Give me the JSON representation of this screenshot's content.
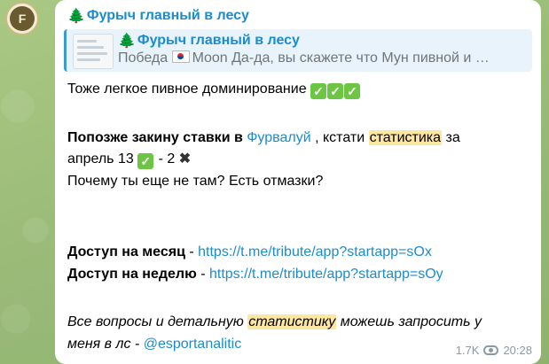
{
  "avatar": {
    "glyph": "F"
  },
  "message": {
    "sender": "Фурыч главный в лесу",
    "reply": {
      "title": "Фурыч главный в лесу",
      "text_prefix": "Победа",
      "text_rest": "Moon Да-да, вы скажете что Мун пивной и …"
    },
    "line1": "Тоже легкое пивное доминирование",
    "line2_bold": "Попозже закину ставки в",
    "line2_link": "Фурвалуй",
    "line2_rest": ", кстати",
    "line2_highlight": "статистика",
    "line2_tail": "за",
    "line3_prefix": "апрель 13",
    "line3_mid": "- 2",
    "line4": "Почему ты еще не там? Есть отмазки?",
    "month_label": "Доступ на месяц",
    "month_link": "https://t.me/tribute/app?startapp=sOx",
    "week_label": "Доступ на неделю",
    "week_link": "https://t.me/tribute/app?startapp=sOy",
    "footer_pre": "Все вопросы и детальную",
    "footer_highlight": "статистику",
    "footer_post": "можешь запросить у",
    "footer_line2": "меня в лс -",
    "footer_handle": "@esportanalitic",
    "views": "1.7K",
    "time": "20:28",
    "dash": "-",
    "check_glyph": "✓",
    "cross_glyph": "✖",
    "tree_glyph": "🌲"
  }
}
